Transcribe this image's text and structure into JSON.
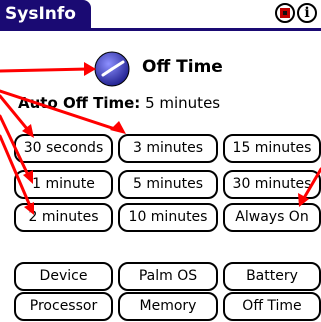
{
  "title": "SysInfo",
  "heading": "Off Time",
  "auto_off": {
    "label": "Auto Off Time:",
    "value": "5 minutes"
  },
  "header_icons": [
    "battery-icon",
    "info-icon"
  ],
  "info_glyph": "i",
  "timeout_options": [
    "30 seconds",
    "3 minutes",
    "15 minutes",
    "1 minute",
    "5 minutes",
    "30 minutes",
    "2 minutes",
    "10 minutes",
    "Always On"
  ],
  "sections": [
    "Device",
    "Palm OS",
    "Battery",
    "Processor",
    "Memory",
    "Off Time"
  ],
  "colors": {
    "title_bar": "#1a0a73",
    "annotation_arrows": "#ff0000"
  }
}
